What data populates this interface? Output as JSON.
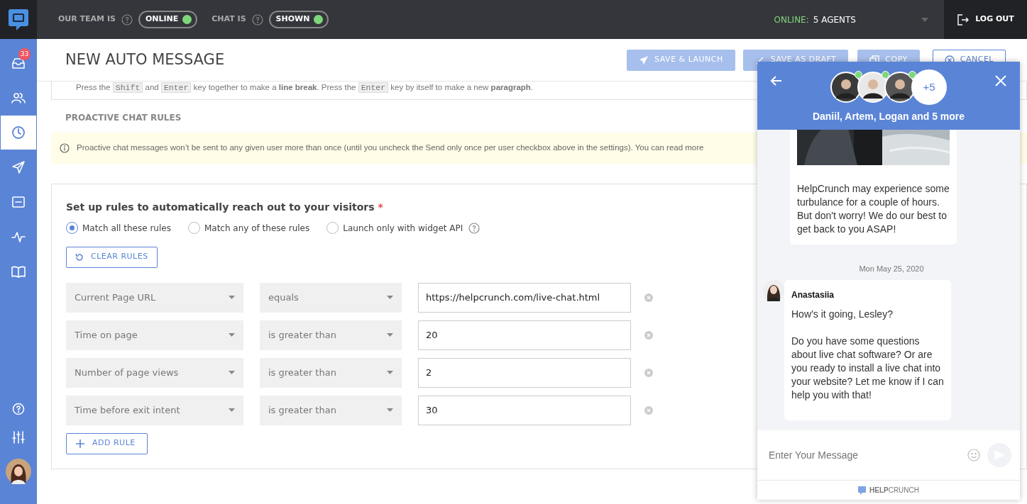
{
  "topbar": {
    "team_label": "OUR TEAM IS",
    "team_status": {
      "label": "ONLINE",
      "on": true
    },
    "chat_label": "CHAT IS",
    "chat_status": {
      "label": "SHOWN",
      "on": true
    },
    "online_label": "ONLINE:",
    "online_value": "5 AGENTS",
    "logout": "LOG OUT"
  },
  "sidebar": {
    "items": [
      {
        "kind": "inbox",
        "badge": "33",
        "selected": false
      },
      {
        "kind": "people",
        "selected": false
      },
      {
        "kind": "clock",
        "selected": true
      },
      {
        "kind": "send",
        "selected": false
      },
      {
        "kind": "card",
        "selected": false
      },
      {
        "kind": "pulse",
        "selected": false
      },
      {
        "kind": "book",
        "selected": false
      }
    ],
    "bottom": [
      {
        "kind": "help"
      },
      {
        "kind": "sliders"
      },
      {
        "kind": "avatar"
      }
    ]
  },
  "page": {
    "title": "NEW AUTO MESSAGE",
    "buttons": [
      {
        "label": "SAVE & LAUNCH",
        "kind": "primary"
      },
      {
        "label": "SAVE AS DRAFT",
        "kind": "primary"
      },
      {
        "label": "COPY",
        "kind": "primary"
      },
      {
        "label": "CANCEL",
        "kind": "outline"
      }
    ]
  },
  "hint": [
    {
      "kind": "plain",
      "text": "Press the "
    },
    {
      "kind": "key",
      "text": "Shift"
    },
    {
      "kind": "plain",
      "text": " and "
    },
    {
      "kind": "key",
      "text": "Enter"
    },
    {
      "kind": "plain",
      "text": " key together to make a "
    },
    {
      "kind": "bold",
      "text": "line break"
    },
    {
      "kind": "plain",
      "text": ". Press the "
    },
    {
      "kind": "key",
      "text": "Enter"
    },
    {
      "kind": "plain",
      "text": " key by itself to make a new "
    },
    {
      "kind": "bold",
      "text": "paragraph"
    },
    {
      "kind": "plain",
      "text": "."
    }
  ],
  "section_title": "PROACTIVE CHAT RULES",
  "notice": "Proactive chat messages won’t be sent to any given user more than once (until you uncheck the Send only once per user checkbox above in the settings). You can read more",
  "rules_card": {
    "title": "Set up rules to automatically reach out to your visitors",
    "required": "*",
    "options": [
      {
        "label": "Match all these rules",
        "selected": true,
        "help": false
      },
      {
        "label": "Match any of these rules",
        "selected": false,
        "help": false
      },
      {
        "label": "Launch only with widget API",
        "selected": false,
        "help": true
      }
    ],
    "clear": "CLEAR RULES",
    "rules": [
      {
        "field": "Current Page URL",
        "operator": "equals",
        "value": "https://helpcrunch.com/live-chat.html"
      },
      {
        "field": "Time on page",
        "operator": "is greater than",
        "value": "20"
      },
      {
        "field": "Number of page views",
        "operator": "is greater than",
        "value": "2"
      },
      {
        "field": "Time before exit intent",
        "operator": "is greater than",
        "value": "30"
      }
    ],
    "add": "ADD RULE"
  },
  "chat": {
    "agents": [
      {
        "online": true
      },
      {
        "online": true
      },
      {
        "online": true
      }
    ],
    "more": "+5",
    "names": "Daniil, Artem, Logan and 5 more",
    "messages": [
      {
        "kind": "bubble",
        "picture": true,
        "text": "HelpCrunch may experience some turbulance for a couple of hours. But don't worry! We do our best to get back to you ASAP!"
      },
      {
        "kind": "date",
        "text": "Mon May 25, 2020"
      },
      {
        "kind": "bubble",
        "author": "Anastasiia",
        "paragraphs": [
          "How’s it going, Lesley?",
          "Do you have some questions about live chat software? Or are you ready to install a live chat into your website? Let me know if I can help you with that!"
        ]
      }
    ],
    "placeholder": "Enter Your Message",
    "brand": "**HELP**CRUNCH"
  }
}
